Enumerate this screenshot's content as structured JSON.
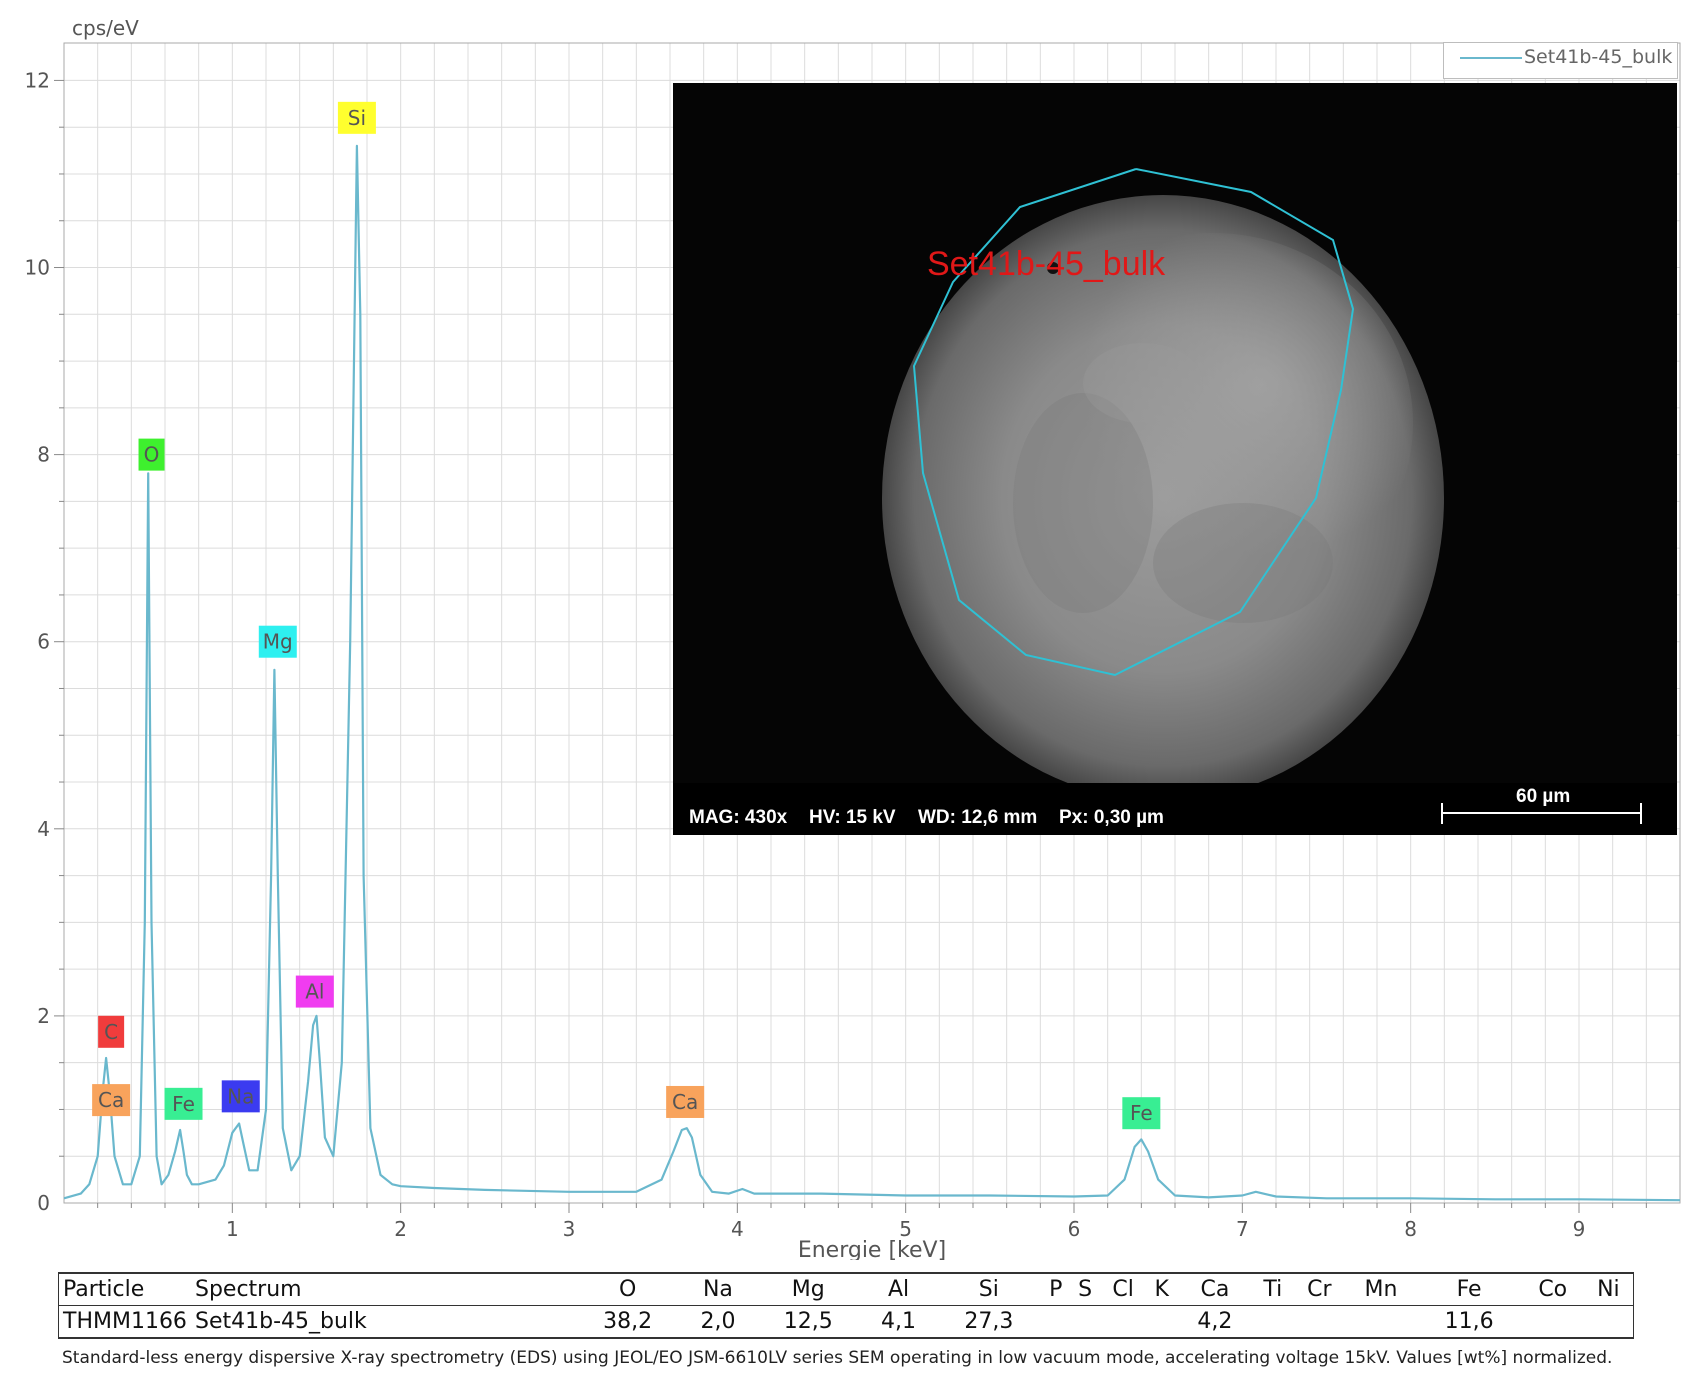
{
  "chart_data": {
    "type": "line",
    "ylabel": "cps/eV",
    "xlabel": "Energie [keV]",
    "xlim": [
      0,
      9.6
    ],
    "ylim": [
      0,
      12.4
    ],
    "x_ticks": [
      1,
      2,
      3,
      4,
      5,
      6,
      7,
      8,
      9
    ],
    "y_ticks": [
      0,
      2,
      4,
      6,
      8,
      10,
      12
    ],
    "grid": true,
    "legend_position": "top-right",
    "series": [
      {
        "name": "Set41b-45_bulk",
        "color": "#6ab8cd",
        "x": [
          0.0,
          0.1,
          0.15,
          0.2,
          0.23,
          0.25,
          0.27,
          0.3,
          0.35,
          0.4,
          0.45,
          0.48,
          0.5,
          0.52,
          0.55,
          0.58,
          0.62,
          0.66,
          0.69,
          0.71,
          0.73,
          0.76,
          0.8,
          0.9,
          0.95,
          1.0,
          1.04,
          1.07,
          1.1,
          1.15,
          1.2,
          1.23,
          1.25,
          1.27,
          1.3,
          1.35,
          1.4,
          1.45,
          1.48,
          1.5,
          1.52,
          1.55,
          1.6,
          1.65,
          1.7,
          1.74,
          1.76,
          1.78,
          1.82,
          1.88,
          1.95,
          2.0,
          2.2,
          2.5,
          3.0,
          3.4,
          3.55,
          3.62,
          3.67,
          3.7,
          3.73,
          3.78,
          3.85,
          3.95,
          4.03,
          4.1,
          4.5,
          5.0,
          5.5,
          6.0,
          6.2,
          6.3,
          6.36,
          6.4,
          6.44,
          6.5,
          6.6,
          6.8,
          7.0,
          7.08,
          7.2,
          7.5,
          8.0,
          8.5,
          9.0,
          9.6
        ],
        "values": [
          0.05,
          0.1,
          0.2,
          0.5,
          1.2,
          1.55,
          1.2,
          0.5,
          0.2,
          0.2,
          0.5,
          3.0,
          7.8,
          3.0,
          0.5,
          0.2,
          0.3,
          0.55,
          0.78,
          0.55,
          0.3,
          0.2,
          0.2,
          0.25,
          0.4,
          0.75,
          0.85,
          0.6,
          0.35,
          0.35,
          1.0,
          3.5,
          5.7,
          3.5,
          0.8,
          0.35,
          0.5,
          1.3,
          1.9,
          2.0,
          1.5,
          0.7,
          0.5,
          1.5,
          6.0,
          11.3,
          9.5,
          3.5,
          0.8,
          0.3,
          0.2,
          0.18,
          0.16,
          0.14,
          0.12,
          0.12,
          0.25,
          0.55,
          0.78,
          0.8,
          0.7,
          0.3,
          0.12,
          0.1,
          0.15,
          0.1,
          0.1,
          0.08,
          0.08,
          0.07,
          0.08,
          0.25,
          0.6,
          0.68,
          0.55,
          0.25,
          0.08,
          0.06,
          0.08,
          0.12,
          0.07,
          0.05,
          0.05,
          0.04,
          0.04,
          0.03
        ]
      }
    ],
    "peak_labels": [
      {
        "text": "C",
        "x": 0.28,
        "y": 1.83,
        "color": "#f03c3c"
      },
      {
        "text": "Ca",
        "x": 0.28,
        "y": 1.1,
        "color": "#f8a35c"
      },
      {
        "text": "O",
        "x": 0.52,
        "y": 8.0,
        "color": "#3ef02e"
      },
      {
        "text": "Fe",
        "x": 0.71,
        "y": 1.06,
        "color": "#38ee93"
      },
      {
        "text": "Na",
        "x": 1.05,
        "y": 1.14,
        "color": "#3b3bf0"
      },
      {
        "text": "Mg",
        "x": 1.27,
        "y": 6.0,
        "color": "#2ef0f0"
      },
      {
        "text": "Al",
        "x": 1.49,
        "y": 2.26,
        "color": "#f03cf0"
      },
      {
        "text": "Si",
        "x": 1.74,
        "y": 11.6,
        "color": "#ffff2e"
      },
      {
        "text": "Ca",
        "x": 3.69,
        "y": 1.08,
        "color": "#f8a35c"
      },
      {
        "text": "Fe",
        "x": 6.4,
        "y": 0.96,
        "color": "#38ee93"
      }
    ]
  },
  "inset": {
    "region_label": "Set41b-45_bulk",
    "info": [
      "MAG: 430x",
      "HV: 15 kV",
      "WD: 12,6 mm",
      "Px: 0,30 µm"
    ],
    "scale_bar": "60 µm"
  },
  "results_table": {
    "headers": [
      "Particle",
      "Spectrum",
      "O",
      "Na",
      "Mg",
      "Al",
      "Si",
      "P",
      "S",
      "Cl",
      "K",
      "Ca",
      "Ti",
      "Cr",
      "Mn",
      "Fe",
      "Co",
      "Ni"
    ],
    "row": [
      "THMM1166",
      "Set41b-45_bulk",
      "38,2",
      "2,0",
      "12,5",
      "4,1",
      "27,3",
      "",
      "",
      "",
      "",
      "4,2",
      "",
      "",
      "",
      "11,6",
      "",
      ""
    ]
  },
  "footnote": "Standard-less energy dispersive X-ray spectrometry (EDS) using JEOL/EO JSM-6610LV series SEM operating in low vacuum mode, accelerating voltage 15kV. Values [wt%] normalized."
}
